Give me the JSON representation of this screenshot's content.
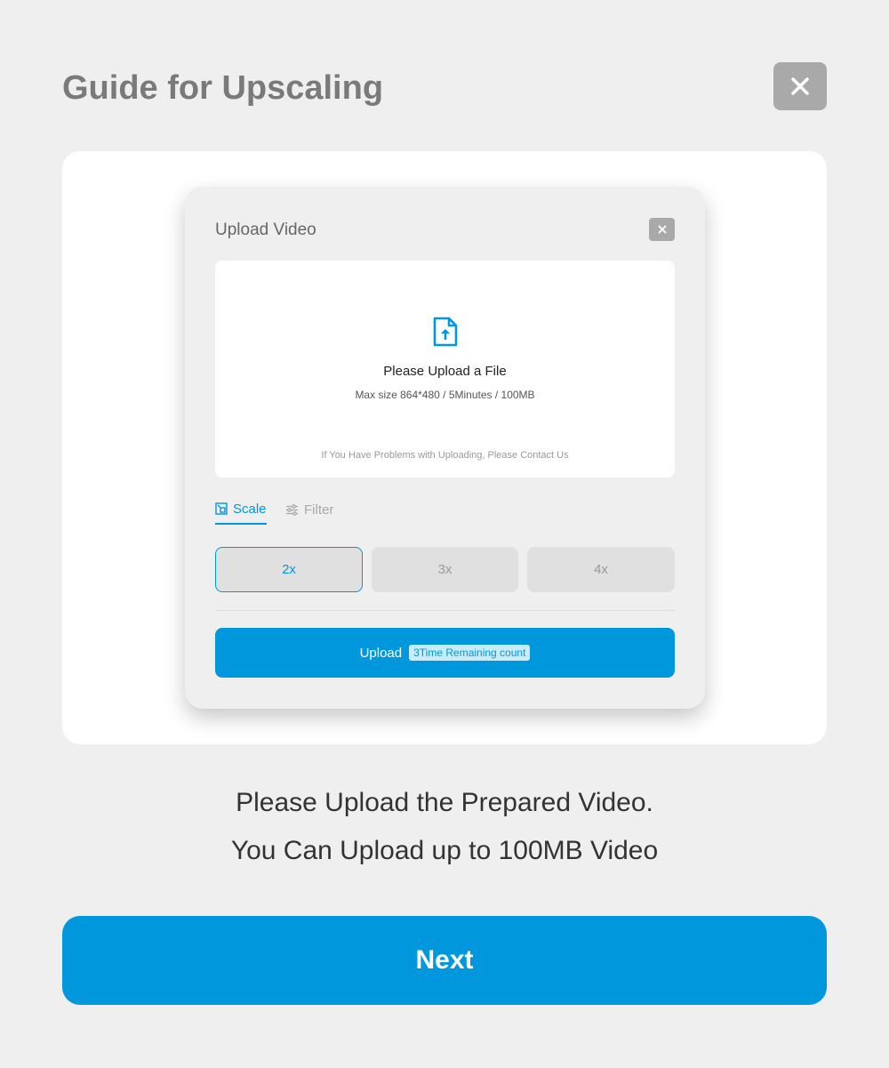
{
  "header": {
    "title": "Guide for Upscaling"
  },
  "close_icon": "close-icon",
  "modal": {
    "title": "Upload Video",
    "dropzone": {
      "title": "Please Upload a File",
      "limits": "Max size 864*480 / 5Minutes / 100MB",
      "help": "If You Have Problems with Uploading, Please Contact Us"
    },
    "tabs": [
      {
        "label": "Scale",
        "icon": "scale-icon",
        "active": true
      },
      {
        "label": "Filter",
        "icon": "filter-icon",
        "active": false
      }
    ],
    "scales": [
      {
        "label": "2x",
        "active": true
      },
      {
        "label": "3x",
        "active": false
      },
      {
        "label": "4x",
        "active": false
      }
    ],
    "upload": {
      "label": "Upload",
      "badge": "3Time Remaining count"
    }
  },
  "description": {
    "line1": "Please Upload the Prepared Video.",
    "line2": "You Can Upload up to 100MB Video"
  },
  "next_label": "Next",
  "colors": {
    "accent": "#0097dc",
    "close_bg": "#a9a9a9",
    "page_bg": "#efefef"
  }
}
